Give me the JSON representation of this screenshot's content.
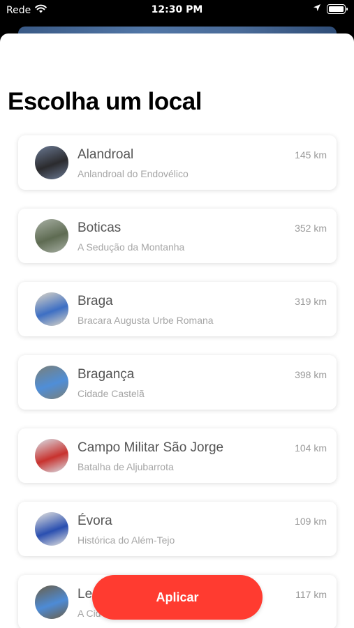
{
  "status_bar": {
    "carrier": "Rede",
    "time": "12:30 PM",
    "icons": [
      "wifi-icon",
      "location-arrow-icon",
      "battery-icon"
    ]
  },
  "sheet": {
    "title": "Escolha um local"
  },
  "locations": [
    {
      "name": "Alandroal",
      "subtitle": "Anlandroal do Endovélico",
      "distance": "145 km",
      "photo_colors": [
        "#2b2b2e",
        "#6b7a94"
      ]
    },
    {
      "name": "Boticas",
      "subtitle": "A Sedução da Montanha",
      "distance": "352 km",
      "photo_colors": [
        "#5e6b52",
        "#a8b0a4"
      ]
    },
    {
      "name": "Braga",
      "subtitle": "Bracara Augusta Urbe Romana",
      "distance": "319 km",
      "photo_colors": [
        "#3d6fc4",
        "#ddd6c6"
      ]
    },
    {
      "name": "Bragança",
      "subtitle": "Cidade Castelã",
      "distance": "398 km",
      "photo_colors": [
        "#4f8ed8",
        "#7a7f78"
      ]
    },
    {
      "name": "Campo Militar São Jorge",
      "subtitle": "Batalha de Aljubarrota",
      "distance": "104 km",
      "photo_colors": [
        "#c8322e",
        "#d9e2ea"
      ]
    },
    {
      "name": "Évora",
      "subtitle": "Histórica do Além-Tejo",
      "distance": "109 km",
      "photo_colors": [
        "#2a4fb0",
        "#e8e6e0"
      ]
    },
    {
      "name": "Le",
      "subtitle": "A Cid",
      "distance": "117 km",
      "photo_colors": [
        "#4d8bd6",
        "#6b5e46"
      ]
    }
  ],
  "apply_button": {
    "label": "Aplicar",
    "color": "#ff3b30"
  }
}
